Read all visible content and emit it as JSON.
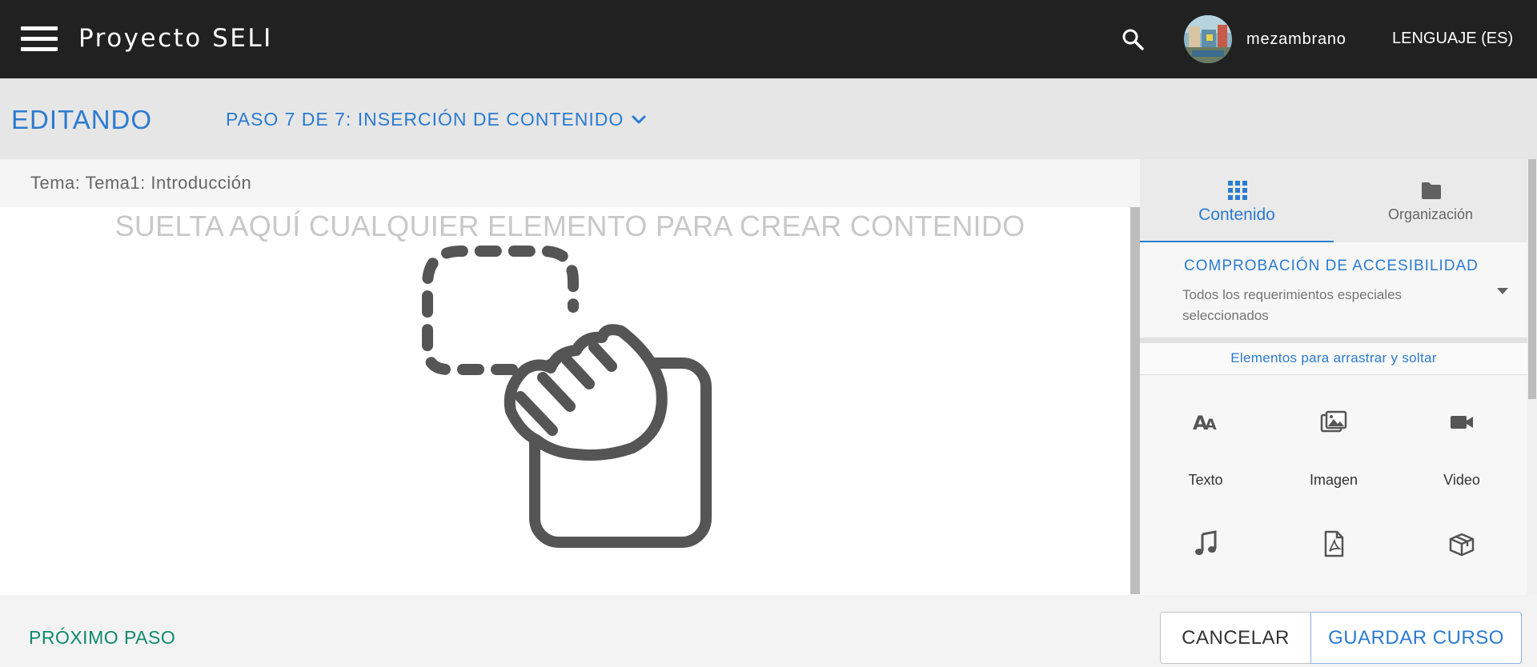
{
  "appbar": {
    "title": "Proyecto SELI",
    "menu_icon": "hamburger-menu-icon",
    "search_icon": "search-icon",
    "username": "mezambrano",
    "language": "LENGUAJE (ES)"
  },
  "editbar": {
    "mode_label": "EDITANDO",
    "step_label": "PASO 7 DE 7: INSERCIÓN DE CONTENIDO",
    "step_icon": "chevron-down-icon"
  },
  "topic": {
    "label": "Tema: Tema1: Introducción"
  },
  "canvas": {
    "drop_text": "SUELTA AQUÍ CUALQUIER ELEMENTO PARA CREAR CONTENIDO",
    "illustration": "drag-and-drop-hand-icon"
  },
  "panel": {
    "tabs": [
      {
        "label": "Contenido",
        "icon": "grid-icon",
        "active": true
      },
      {
        "label": "Organización",
        "icon": "folder-icon",
        "active": false
      }
    ],
    "accessibility": {
      "title": "COMPROBACIÓN DE ACCESIBILIDAD",
      "subtitle": "Todos los requerimientos especiales seleccionados",
      "icon": "dropdown-arrow-icon"
    },
    "dnd_title": "Elementos para arrastrar y soltar",
    "elements": [
      {
        "label": "Texto",
        "icon": "text-icon"
      },
      {
        "label": "Imagen",
        "icon": "image-icon"
      },
      {
        "label": "Video",
        "icon": "video-icon"
      },
      {
        "label": "",
        "icon": "music-icon"
      },
      {
        "label": "",
        "icon": "pdf-icon"
      },
      {
        "label": "",
        "icon": "package-icon"
      }
    ]
  },
  "footer": {
    "next_step": "PRÓXIMO PASO",
    "cancel": "CANCELAR",
    "save": "GUARDAR CURSO"
  },
  "colors": {
    "appbar": "#212121",
    "accent": "#2b7bd1",
    "next_step": "#0f8a6a",
    "icon_gray": "#555555"
  }
}
